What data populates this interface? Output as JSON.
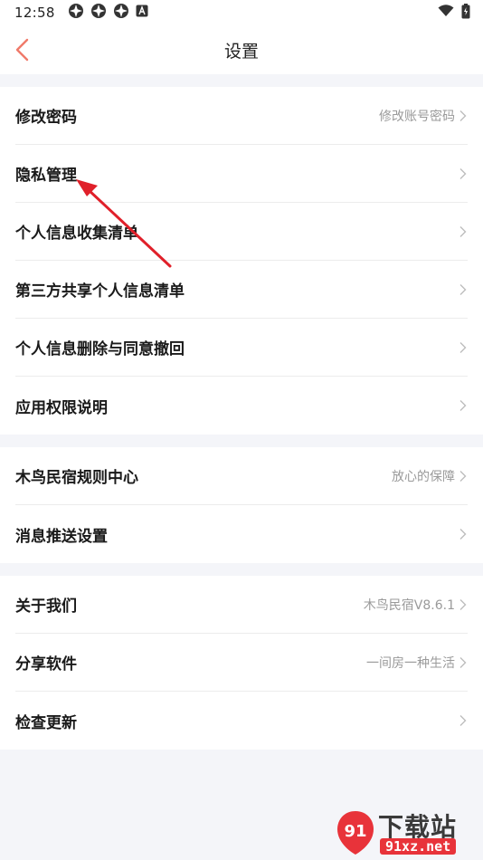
{
  "status_bar": {
    "time": "12:58",
    "icons_left": [
      "app-icon",
      "app-icon",
      "app-icon",
      "a-icon"
    ],
    "icons_right": [
      "wifi-icon",
      "battery-icon"
    ]
  },
  "header": {
    "title": "设置",
    "back_icon": "chevron-left-icon",
    "accent_color": "#f07a6a"
  },
  "groups": [
    {
      "items": [
        {
          "label": "修改密码",
          "value": "修改账号密码"
        },
        {
          "label": "隐私管理",
          "value": ""
        },
        {
          "label": "个人信息收集清单",
          "value": ""
        },
        {
          "label": "第三方共享个人信息清单",
          "value": ""
        },
        {
          "label": "个人信息删除与同意撤回",
          "value": ""
        },
        {
          "label": "应用权限说明",
          "value": ""
        }
      ]
    },
    {
      "items": [
        {
          "label": "木鸟民宿规则中心",
          "value": "放心的保障"
        },
        {
          "label": "消息推送设置",
          "value": ""
        }
      ]
    },
    {
      "items": [
        {
          "label": "关于我们",
          "value": "木鸟民宿V8.6.1"
        },
        {
          "label": "分享软件",
          "value": "一间房一种生活"
        },
        {
          "label": "检查更新",
          "value": ""
        }
      ]
    }
  ],
  "annotation_arrow_color": "#e0202a",
  "watermark": {
    "title": "下载站",
    "url": "91xz.net"
  }
}
